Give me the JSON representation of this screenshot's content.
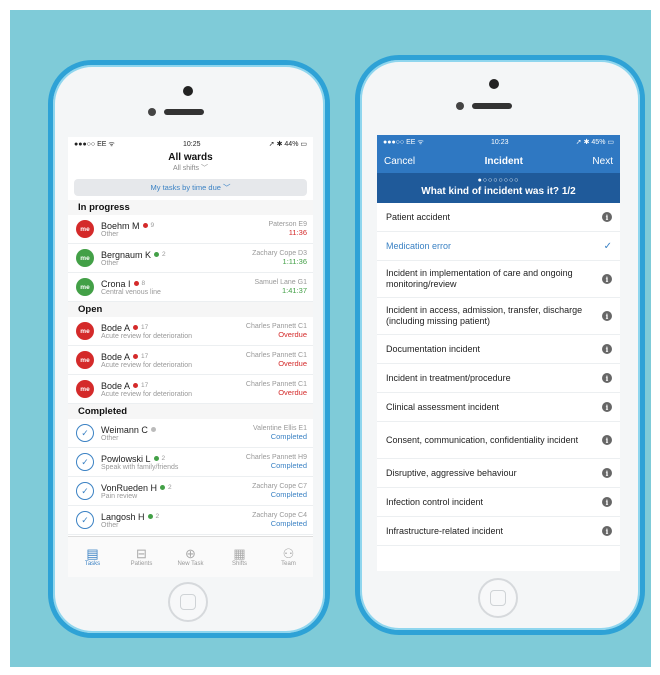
{
  "left": {
    "status": {
      "carrier": "●●●○○ EE ᯤ",
      "time": "10:25",
      "battery": "➚ ✱ 44% ▭"
    },
    "title": "All wards",
    "subtitle": "All shifts ﹀",
    "segment_label": "My tasks by time due ﹀",
    "sections": [
      {
        "label": "In progress",
        "rows": [
          {
            "av": "me",
            "avcolor": "red",
            "name": "Boehm M",
            "dot": "red",
            "num": "9",
            "sub": "Other",
            "asg": "Paterson E9",
            "status": "11:36",
            "scolor": "red"
          },
          {
            "av": "me",
            "avcolor": "green",
            "name": "Bergnaum K",
            "dot": "green",
            "num": "2",
            "sub": "Other",
            "asg": "Zachary Cope D3",
            "status": "1:11:36",
            "scolor": "green"
          },
          {
            "av": "me",
            "avcolor": "green",
            "name": "Crona I",
            "dot": "red",
            "num": "8",
            "sub": "Central venous line",
            "asg": "Samuel Lane G1",
            "status": "1:41:37",
            "scolor": "green"
          }
        ]
      },
      {
        "label": "Open",
        "rows": [
          {
            "av": "me",
            "avcolor": "red",
            "name": "Bode A",
            "dot": "red",
            "num": "17",
            "sub": "Acute review for deterioration",
            "asg": "Charles Pannett C1",
            "status": "Overdue",
            "scolor": "red"
          },
          {
            "av": "me",
            "avcolor": "red",
            "name": "Bode A",
            "dot": "red",
            "num": "17",
            "sub": "Acute review for deterioration",
            "asg": "Charles Pannett C1",
            "status": "Overdue",
            "scolor": "red"
          },
          {
            "av": "me",
            "avcolor": "red",
            "name": "Bode A",
            "dot": "red",
            "num": "17",
            "sub": "Acute review for deterioration",
            "asg": "Charles Pannett C1",
            "status": "Overdue",
            "scolor": "red"
          }
        ]
      },
      {
        "label": "Completed",
        "rows": [
          {
            "av": "check",
            "name": "Weimann C",
            "dot": "grey",
            "num": "",
            "sub": "Other",
            "asg": "Valentine Ellis E1",
            "status": "Completed",
            "scolor": "blue"
          },
          {
            "av": "check",
            "name": "Powlowski L",
            "dot": "green",
            "num": "2",
            "sub": "Speak with family/friends",
            "asg": "Charles Pannett H9",
            "status": "Completed",
            "scolor": "blue"
          },
          {
            "av": "check",
            "name": "VonRueden H",
            "dot": "green",
            "num": "2",
            "sub": "Pain review",
            "asg": "Zachary Cope C7",
            "status": "Completed",
            "scolor": "blue"
          },
          {
            "av": "check",
            "name": "Langosh H",
            "dot": "green",
            "num": "2",
            "sub": "Other",
            "asg": "Zachary Cope C4",
            "status": "Completed",
            "scolor": "blue"
          }
        ]
      }
    ],
    "tabs": [
      {
        "label": "Tasks",
        "icon": "clipboard-icon",
        "glyph": "▤",
        "active": true
      },
      {
        "label": "Patients",
        "icon": "bed-icon",
        "glyph": "⊟",
        "active": false
      },
      {
        "label": "New Task",
        "icon": "plus-circle-icon",
        "glyph": "⊕",
        "active": false
      },
      {
        "label": "Shifts",
        "icon": "calendar-icon",
        "glyph": "▦",
        "active": false
      },
      {
        "label": "Team",
        "icon": "team-icon",
        "glyph": "⚇",
        "active": false
      }
    ]
  },
  "right": {
    "status": {
      "carrier": "●●●○○ EE ᯤ",
      "time": "10:23",
      "battery": "➚ ✱ 45% ▭"
    },
    "cancel": "Cancel",
    "title": "Incident",
    "next": "Next",
    "progress_dots": "●○○○○○○○",
    "question": "What kind of incident was it? 1/2",
    "options": [
      {
        "label": "Patient accident",
        "selected": false,
        "h": 28
      },
      {
        "label": "Medication error",
        "selected": true,
        "h": 28
      },
      {
        "label": "Incident in implementation of care and ongoing monitoring/review",
        "selected": false,
        "h": 36
      },
      {
        "label": "Incident in access, admission, transfer, discharge (including missing patient)",
        "selected": false,
        "h": 36
      },
      {
        "label": "Documentation incident",
        "selected": false,
        "h": 28
      },
      {
        "label": "Incident in treatment/procedure",
        "selected": false,
        "h": 28
      },
      {
        "label": "Clinical assessment incident",
        "selected": false,
        "h": 28
      },
      {
        "label": "Consent, communication, confidentiality incident",
        "selected": false,
        "h": 36
      },
      {
        "label": "Disruptive, aggressive behaviour",
        "selected": false,
        "h": 28
      },
      {
        "label": "Infection control incident",
        "selected": false,
        "h": 28
      },
      {
        "label": "Infrastructure-related incident",
        "selected": false,
        "h": 28
      }
    ],
    "info_glyph": "i",
    "check_glyph": "✓"
  }
}
